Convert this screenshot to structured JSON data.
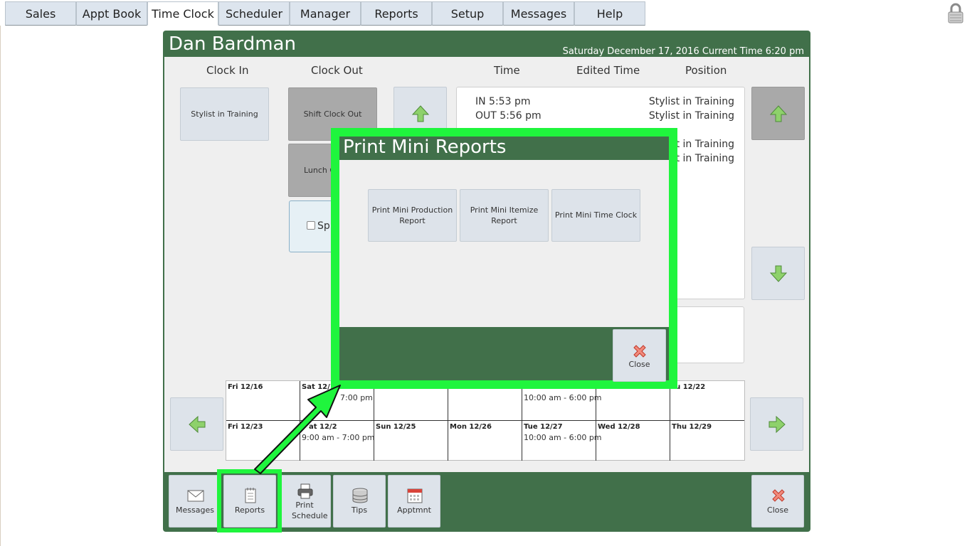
{
  "nav": {
    "tabs": [
      "Sales",
      "Appt Book",
      "Time Clock",
      "Scheduler",
      "Manager",
      "Reports",
      "Setup",
      "Messages",
      "Help"
    ],
    "active": "Time Clock"
  },
  "header": {
    "name": "Dan Bardman",
    "datetime": "Saturday December 17, 2016 Current Time 6:20 pm"
  },
  "columns": {
    "clock_in": "Clock In",
    "clock_out": "Clock Out",
    "time": "Time",
    "edited_time": "Edited Time",
    "position": "Position"
  },
  "clock_in_buttons": [
    "Stylist in Training"
  ],
  "clock_out_buttons": [
    "Shift Clock Out",
    "Lunch C"
  ],
  "split_label": "Spl",
  "time_entries": [
    {
      "time": "IN 5:53 pm",
      "position": "Stylist in Training"
    },
    {
      "time": "OUT 5:56 pm",
      "position": "Stylist in Training"
    },
    {
      "time": "",
      "position": "st in Training"
    },
    {
      "time": "",
      "position": "st in Training"
    }
  ],
  "calendar": {
    "week1": [
      {
        "day": "Fri 12/16",
        "shift": ""
      },
      {
        "day": "Sat 12/1",
        "shift": "7:00 pm"
      },
      {
        "day": "",
        "shift": ""
      },
      {
        "day": "",
        "shift": ""
      },
      {
        "day": "",
        "shift": "10:00 am - 6:00 pm"
      },
      {
        "day": "",
        "shift": ""
      },
      {
        "day": "hu 12/22",
        "shift": ""
      }
    ],
    "week2": [
      {
        "day": "Fri 12/23",
        "shift": ""
      },
      {
        "day": "at 12/2",
        "shift": "9:00 am - 7:00 pm"
      },
      {
        "day": "Sun 12/25",
        "shift": ""
      },
      {
        "day": "Mon 12/26",
        "shift": ""
      },
      {
        "day": "Tue 12/27",
        "shift": "10:00 am - 6:00 pm"
      },
      {
        "day": "Wed 12/28",
        "shift": ""
      },
      {
        "day": "Thu 12/29",
        "shift": ""
      }
    ]
  },
  "bottom": {
    "messages": "Messages",
    "reports": "Reports",
    "print_schedule": "Print Schedule",
    "tips": "Tips",
    "apptmnt": "Apptmnt",
    "close": "Close"
  },
  "modal": {
    "title": "Print Mini Reports",
    "buttons": [
      "Print Mini Production Report",
      "Print Mini Itemize Report",
      "Print Mini Time Clock"
    ],
    "close": "Close"
  },
  "colors": {
    "panel_green": "#41704a",
    "highlight_green": "#1ff53d",
    "button_bg": "#dde3ea"
  }
}
